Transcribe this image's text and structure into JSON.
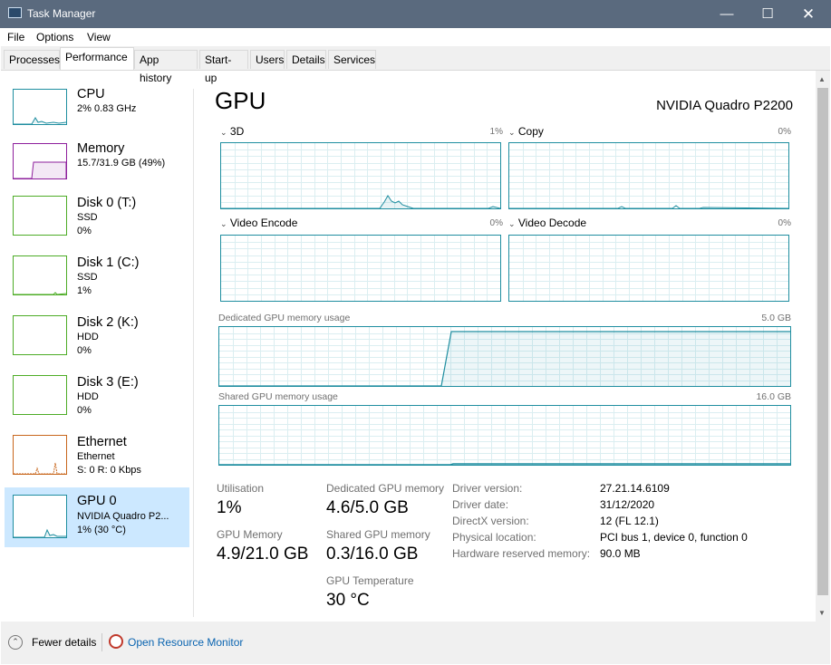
{
  "window": {
    "title": "Task Manager"
  },
  "menu": [
    "File",
    "Options",
    "View"
  ],
  "tabs": [
    "Processes",
    "Performance",
    "App history",
    "Start-up",
    "Users",
    "Details",
    "Services"
  ],
  "active_tab": "Performance",
  "sidebar": [
    {
      "name": "CPU",
      "line2": "2%  0.83 GHz",
      "line3": "",
      "color": "#1f8ea0",
      "level": 0.02
    },
    {
      "name": "Memory",
      "line2": "15.7/31.9 GB (49%)",
      "line3": "",
      "color": "#8e1f9c",
      "level": 0.49
    },
    {
      "name": "Disk 0 (T:)",
      "line2": "SSD",
      "line3": "0%",
      "color": "#4dac26",
      "level": 0
    },
    {
      "name": "Disk 1 (C:)",
      "line2": "SSD",
      "line3": "1%",
      "color": "#4dac26",
      "level": 0.01
    },
    {
      "name": "Disk 2 (K:)",
      "line2": "HDD",
      "line3": "0%",
      "color": "#4dac26",
      "level": 0
    },
    {
      "name": "Disk 3 (E:)",
      "line2": "HDD",
      "line3": "0%",
      "color": "#4dac26",
      "level": 0
    },
    {
      "name": "Ethernet",
      "line2": "Ethernet",
      "line3": "S: 0  R: 0 Kbps",
      "color": "#c8661c",
      "level": 0
    },
    {
      "name": "GPU 0",
      "line2": "NVIDIA Quadro P2...",
      "line3": "1% (30 °C)",
      "color": "#1f8ea0",
      "level": 0.01,
      "selected": true
    }
  ],
  "gpu": {
    "title": "GPU",
    "model": "NVIDIA Quadro P2200",
    "engines": [
      {
        "label": "3D",
        "pct": "1%"
      },
      {
        "label": "Copy",
        "pct": "0%"
      },
      {
        "label": "Video Encode",
        "pct": "0%"
      },
      {
        "label": "Video Decode",
        "pct": "0%"
      }
    ],
    "dedicated": {
      "label": "Dedicated GPU memory usage",
      "max": "5.0 GB",
      "level": 0.92
    },
    "shared": {
      "label": "Shared GPU memory usage",
      "max": "16.0 GB",
      "level": 0.02
    },
    "stats": {
      "utilisation_label": "Utilisation",
      "utilisation": "1%",
      "dedicated_label": "Dedicated GPU memory",
      "dedicated": "4.6/5.0 GB",
      "gpu_memory_label": "GPU Memory",
      "gpu_memory": "4.9/21.0 GB",
      "shared_label": "Shared GPU memory",
      "shared": "0.3/16.0 GB",
      "temp_label": "GPU Temperature",
      "temp": "30 °C"
    },
    "info": [
      {
        "k": "Driver version:",
        "v": "27.21.14.6109"
      },
      {
        "k": "Driver date:",
        "v": "31/12/2020"
      },
      {
        "k": "DirectX version:",
        "v": "12 (FL 12.1)"
      },
      {
        "k": "Physical location:",
        "v": "PCI bus 1, device 0, function 0"
      },
      {
        "k": "Hardware reserved memory:",
        "v": "90.0 MB"
      }
    ]
  },
  "bottom": {
    "fewer": "Fewer details",
    "resource_monitor": "Open Resource Monitor"
  }
}
